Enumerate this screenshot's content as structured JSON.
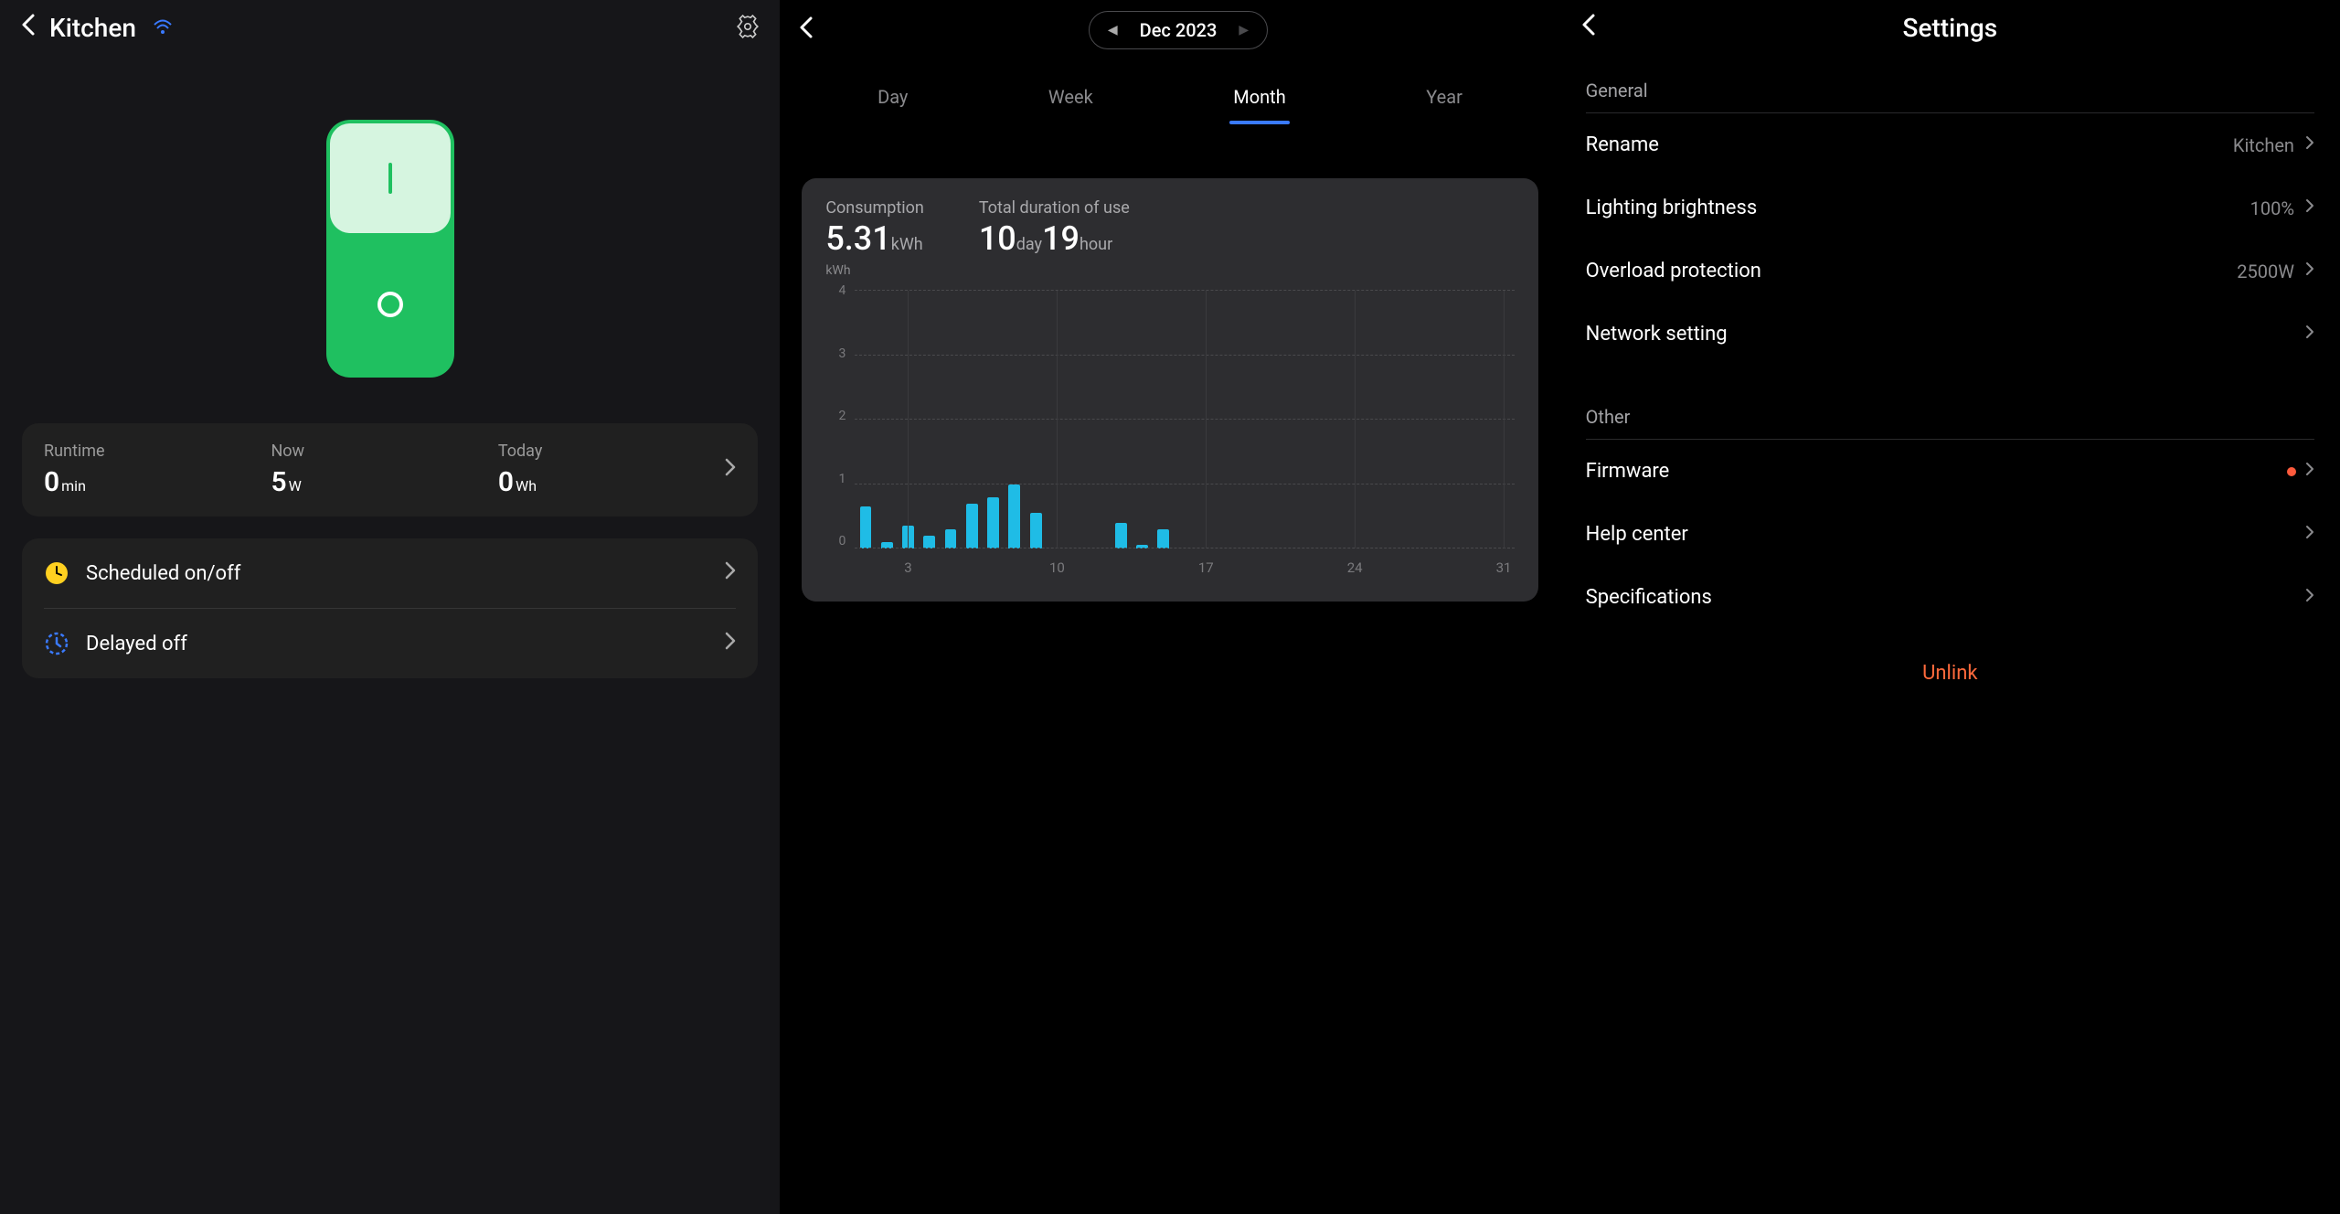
{
  "device": {
    "name": "Kitchen",
    "switch_state": "on",
    "stats": {
      "runtime": {
        "label": "Runtime",
        "value": "0",
        "unit": "min"
      },
      "now": {
        "label": "Now",
        "value": "5",
        "unit": "W"
      },
      "today": {
        "label": "Today",
        "value": "0",
        "unit": "Wh"
      }
    },
    "actions": {
      "scheduled": "Scheduled on/off",
      "delayed": "Delayed off"
    }
  },
  "stats_panel": {
    "period": "Dec 2023",
    "tabs": {
      "day": "Day",
      "week": "Week",
      "month": "Month",
      "year": "Year"
    },
    "active_tab": "month",
    "consumption": {
      "label": "Consumption",
      "value": "5.31",
      "unit": "kWh"
    },
    "duration": {
      "label": "Total duration of use",
      "days": "10",
      "days_unit": "day",
      "hours": "19",
      "hours_unit": "hour"
    },
    "y_unit": "kWh"
  },
  "chart_data": {
    "type": "bar",
    "title": "",
    "xlabel": "",
    "ylabel": "kWh",
    "ylim": [
      0,
      4
    ],
    "y_ticks": [
      0,
      1,
      2,
      3,
      4
    ],
    "x_ticks": [
      3,
      10,
      17,
      24,
      31
    ],
    "categories": [
      1,
      2,
      3,
      4,
      5,
      6,
      7,
      8,
      9,
      10,
      11,
      12,
      13,
      14,
      15,
      16,
      17,
      18,
      19,
      20,
      21,
      22,
      23,
      24,
      25,
      26,
      27,
      28,
      29,
      30,
      31
    ],
    "values": [
      0.65,
      0.1,
      0.35,
      0.2,
      0.3,
      0.7,
      0.8,
      1.0,
      0.55,
      0,
      0,
      0,
      0.4,
      0.05,
      0.3,
      0,
      0,
      0,
      0,
      0,
      0,
      0,
      0,
      0,
      0,
      0,
      0,
      0,
      0,
      0,
      0
    ]
  },
  "settings": {
    "title": "Settings",
    "sections": {
      "general": {
        "title": "General",
        "items": {
          "rename": {
            "label": "Rename",
            "value": "Kitchen"
          },
          "brightness": {
            "label": "Lighting brightness",
            "value": "100%"
          },
          "overload": {
            "label": "Overload protection",
            "value": "2500W"
          },
          "network": {
            "label": "Network setting",
            "value": ""
          }
        }
      },
      "other": {
        "title": "Other",
        "items": {
          "firmware": {
            "label": "Firmware",
            "alert": true
          },
          "help": {
            "label": "Help center"
          },
          "specs": {
            "label": "Specifications"
          }
        }
      }
    },
    "unlink": "Unlink"
  }
}
